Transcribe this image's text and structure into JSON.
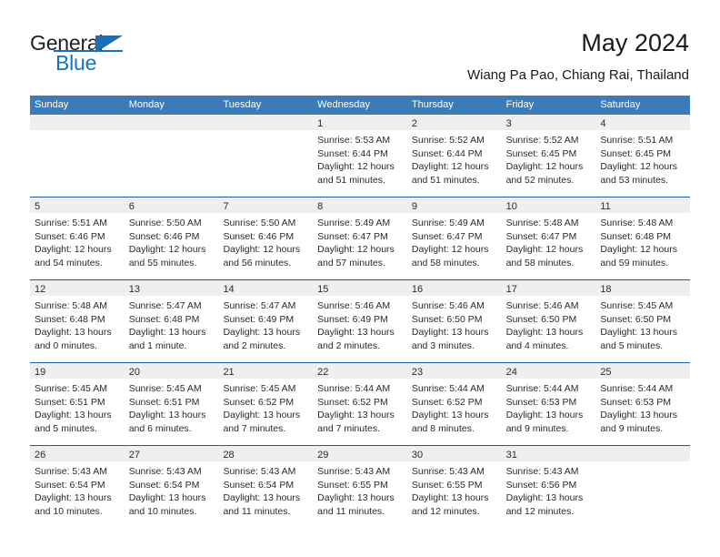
{
  "brand": {
    "name_part1": "General",
    "name_part2": "Blue",
    "logo_icon": "triangle-logo-icon"
  },
  "header": {
    "title": "May 2024",
    "subtitle": "Wiang Pa Pao, Chiang Rai, Thailand"
  },
  "colors": {
    "header_blue": "#3b7cb8",
    "separator_blue": "#1f5c9e",
    "daynum_band": "#efefef",
    "brand_blue": "#1274c4",
    "text": "#2a2a2a"
  },
  "weekdays": [
    "Sunday",
    "Monday",
    "Tuesday",
    "Wednesday",
    "Thursday",
    "Friday",
    "Saturday"
  ],
  "weeks": [
    [
      {
        "day": "",
        "lines": []
      },
      {
        "day": "",
        "lines": []
      },
      {
        "day": "",
        "lines": []
      },
      {
        "day": "1",
        "lines": [
          "Sunrise: 5:53 AM",
          "Sunset: 6:44 PM",
          "Daylight: 12 hours",
          "and 51 minutes."
        ]
      },
      {
        "day": "2",
        "lines": [
          "Sunrise: 5:52 AM",
          "Sunset: 6:44 PM",
          "Daylight: 12 hours",
          "and 51 minutes."
        ]
      },
      {
        "day": "3",
        "lines": [
          "Sunrise: 5:52 AM",
          "Sunset: 6:45 PM",
          "Daylight: 12 hours",
          "and 52 minutes."
        ]
      },
      {
        "day": "4",
        "lines": [
          "Sunrise: 5:51 AM",
          "Sunset: 6:45 PM",
          "Daylight: 12 hours",
          "and 53 minutes."
        ]
      }
    ],
    [
      {
        "day": "5",
        "lines": [
          "Sunrise: 5:51 AM",
          "Sunset: 6:46 PM",
          "Daylight: 12 hours",
          "and 54 minutes."
        ]
      },
      {
        "day": "6",
        "lines": [
          "Sunrise: 5:50 AM",
          "Sunset: 6:46 PM",
          "Daylight: 12 hours",
          "and 55 minutes."
        ]
      },
      {
        "day": "7",
        "lines": [
          "Sunrise: 5:50 AM",
          "Sunset: 6:46 PM",
          "Daylight: 12 hours",
          "and 56 minutes."
        ]
      },
      {
        "day": "8",
        "lines": [
          "Sunrise: 5:49 AM",
          "Sunset: 6:47 PM",
          "Daylight: 12 hours",
          "and 57 minutes."
        ]
      },
      {
        "day": "9",
        "lines": [
          "Sunrise: 5:49 AM",
          "Sunset: 6:47 PM",
          "Daylight: 12 hours",
          "and 58 minutes."
        ]
      },
      {
        "day": "10",
        "lines": [
          "Sunrise: 5:48 AM",
          "Sunset: 6:47 PM",
          "Daylight: 12 hours",
          "and 58 minutes."
        ]
      },
      {
        "day": "11",
        "lines": [
          "Sunrise: 5:48 AM",
          "Sunset: 6:48 PM",
          "Daylight: 12 hours",
          "and 59 minutes."
        ]
      }
    ],
    [
      {
        "day": "12",
        "lines": [
          "Sunrise: 5:48 AM",
          "Sunset: 6:48 PM",
          "Daylight: 13 hours",
          "and 0 minutes."
        ]
      },
      {
        "day": "13",
        "lines": [
          "Sunrise: 5:47 AM",
          "Sunset: 6:48 PM",
          "Daylight: 13 hours",
          "and 1 minute."
        ]
      },
      {
        "day": "14",
        "lines": [
          "Sunrise: 5:47 AM",
          "Sunset: 6:49 PM",
          "Daylight: 13 hours",
          "and 2 minutes."
        ]
      },
      {
        "day": "15",
        "lines": [
          "Sunrise: 5:46 AM",
          "Sunset: 6:49 PM",
          "Daylight: 13 hours",
          "and 2 minutes."
        ]
      },
      {
        "day": "16",
        "lines": [
          "Sunrise: 5:46 AM",
          "Sunset: 6:50 PM",
          "Daylight: 13 hours",
          "and 3 minutes."
        ]
      },
      {
        "day": "17",
        "lines": [
          "Sunrise: 5:46 AM",
          "Sunset: 6:50 PM",
          "Daylight: 13 hours",
          "and 4 minutes."
        ]
      },
      {
        "day": "18",
        "lines": [
          "Sunrise: 5:45 AM",
          "Sunset: 6:50 PM",
          "Daylight: 13 hours",
          "and 5 minutes."
        ]
      }
    ],
    [
      {
        "day": "19",
        "lines": [
          "Sunrise: 5:45 AM",
          "Sunset: 6:51 PM",
          "Daylight: 13 hours",
          "and 5 minutes."
        ]
      },
      {
        "day": "20",
        "lines": [
          "Sunrise: 5:45 AM",
          "Sunset: 6:51 PM",
          "Daylight: 13 hours",
          "and 6 minutes."
        ]
      },
      {
        "day": "21",
        "lines": [
          "Sunrise: 5:45 AM",
          "Sunset: 6:52 PM",
          "Daylight: 13 hours",
          "and 7 minutes."
        ]
      },
      {
        "day": "22",
        "lines": [
          "Sunrise: 5:44 AM",
          "Sunset: 6:52 PM",
          "Daylight: 13 hours",
          "and 7 minutes."
        ]
      },
      {
        "day": "23",
        "lines": [
          "Sunrise: 5:44 AM",
          "Sunset: 6:52 PM",
          "Daylight: 13 hours",
          "and 8 minutes."
        ]
      },
      {
        "day": "24",
        "lines": [
          "Sunrise: 5:44 AM",
          "Sunset: 6:53 PM",
          "Daylight: 13 hours",
          "and 9 minutes."
        ]
      },
      {
        "day": "25",
        "lines": [
          "Sunrise: 5:44 AM",
          "Sunset: 6:53 PM",
          "Daylight: 13 hours",
          "and 9 minutes."
        ]
      }
    ],
    [
      {
        "day": "26",
        "lines": [
          "Sunrise: 5:43 AM",
          "Sunset: 6:54 PM",
          "Daylight: 13 hours",
          "and 10 minutes."
        ]
      },
      {
        "day": "27",
        "lines": [
          "Sunrise: 5:43 AM",
          "Sunset: 6:54 PM",
          "Daylight: 13 hours",
          "and 10 minutes."
        ]
      },
      {
        "day": "28",
        "lines": [
          "Sunrise: 5:43 AM",
          "Sunset: 6:54 PM",
          "Daylight: 13 hours",
          "and 11 minutes."
        ]
      },
      {
        "day": "29",
        "lines": [
          "Sunrise: 5:43 AM",
          "Sunset: 6:55 PM",
          "Daylight: 13 hours",
          "and 11 minutes."
        ]
      },
      {
        "day": "30",
        "lines": [
          "Sunrise: 5:43 AM",
          "Sunset: 6:55 PM",
          "Daylight: 13 hours",
          "and 12 minutes."
        ]
      },
      {
        "day": "31",
        "lines": [
          "Sunrise: 5:43 AM",
          "Sunset: 6:56 PM",
          "Daylight: 13 hours",
          "and 12 minutes."
        ]
      },
      {
        "day": "",
        "lines": []
      }
    ]
  ]
}
